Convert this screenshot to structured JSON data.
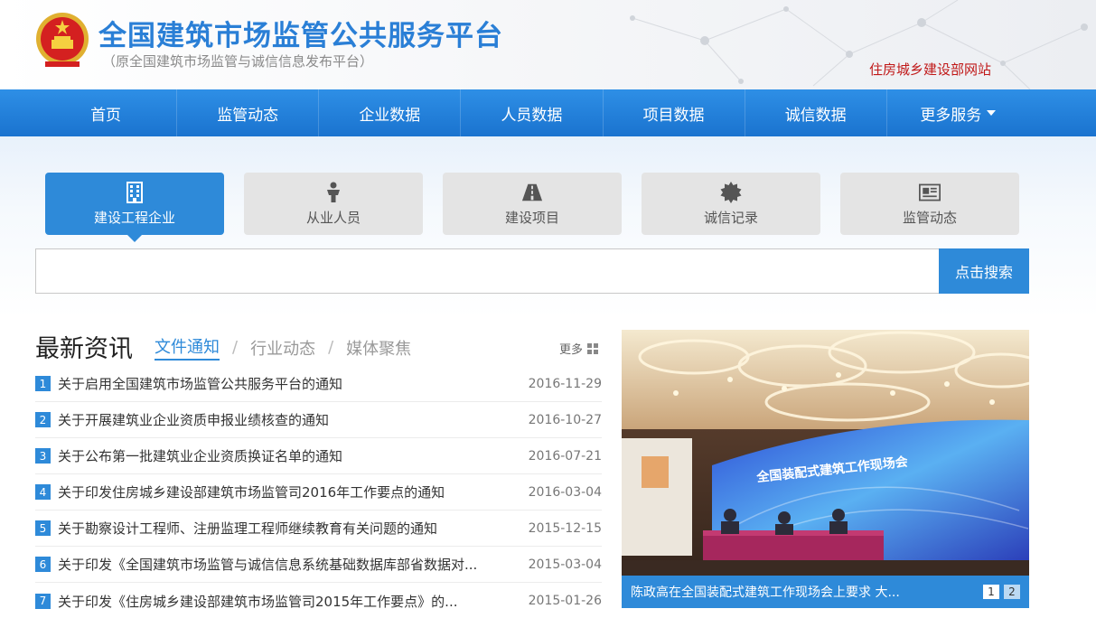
{
  "header": {
    "title": "全国建筑市场监管公共服务平台",
    "subtitle": "（原全国建筑市场监管与诚信信息发布平台）",
    "ministry_link": "住房城乡建设部网站"
  },
  "nav": {
    "items": [
      "首页",
      "监管动态",
      "企业数据",
      "人员数据",
      "项目数据",
      "诚信数据",
      "更多服务"
    ]
  },
  "categories": [
    {
      "label": "建设工程企业",
      "icon": "building-icon",
      "active": true
    },
    {
      "label": "从业人员",
      "icon": "person-icon",
      "active": false
    },
    {
      "label": "建设项目",
      "icon": "road-icon",
      "active": false
    },
    {
      "label": "诚信记录",
      "icon": "seal-icon",
      "active": false
    },
    {
      "label": "监管动态",
      "icon": "newspaper-icon",
      "active": false
    }
  ],
  "search": {
    "placeholder": "",
    "button_label": "点击搜索"
  },
  "news": {
    "title": "最新资讯",
    "tabs": [
      "文件通知",
      "行业动态",
      "媒体聚焦"
    ],
    "separator": "/",
    "more_label": "更多",
    "items": [
      {
        "num": "1",
        "text": "关于启用全国建筑市场监管公共服务平台的通知",
        "date": "2016-11-29"
      },
      {
        "num": "2",
        "text": "关于开展建筑业企业资质申报业绩核查的通知",
        "date": "2016-10-27"
      },
      {
        "num": "3",
        "text": "关于公布第一批建筑业企业资质换证名单的通知",
        "date": "2016-07-21"
      },
      {
        "num": "4",
        "text": "关于印发住房城乡建设部建筑市场监管司2016年工作要点的通知",
        "date": "2016-03-04"
      },
      {
        "num": "5",
        "text": "关于勘察设计工程师、注册监理工程师继续教育有关问题的通知",
        "date": "2015-12-15"
      },
      {
        "num": "6",
        "text": "关于印发《全国建筑市场监管与诚信信息系统基础数据库部省数据对...",
        "date": "2015-03-04"
      },
      {
        "num": "7",
        "text": "关于印发《住房城乡建设部建筑市场监管司2015年工作要点》的...",
        "date": "2015-01-26"
      }
    ]
  },
  "photo": {
    "screen_text": "全国装配式建筑工作现场会",
    "caption": "陈政高在全国装配式建筑工作现场会上要求 大...",
    "pages": [
      "1",
      "2"
    ]
  },
  "colors": {
    "accent": "#2e8ad9",
    "title_blue": "#2a7fd6",
    "link_red": "#c01818"
  }
}
